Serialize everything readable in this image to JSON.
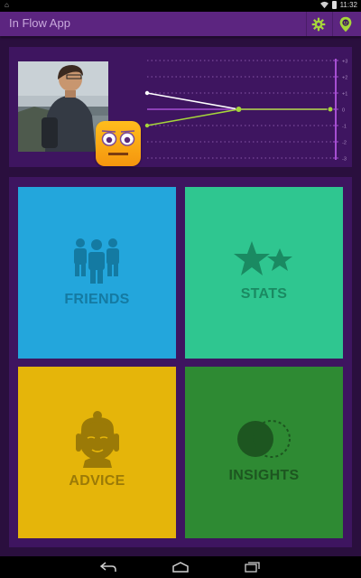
{
  "status_bar": {
    "time": "11:32"
  },
  "app_bar": {
    "title": "In Flow App",
    "actions": [
      {
        "name": "settings",
        "icon": "gear-icon"
      },
      {
        "name": "location",
        "icon": "map-pin-icon"
      }
    ]
  },
  "mood_graph": {
    "y_ticks": [
      "+3",
      "+2",
      "+1",
      "0",
      "-1",
      "-2",
      "-3"
    ],
    "series": [
      {
        "color": "#ffffff",
        "points": [
          {
            "x": 0,
            "y": 1
          },
          {
            "x": 0.5,
            "y": 0
          }
        ]
      },
      {
        "color": "#a6d63a",
        "points": [
          {
            "x": 0,
            "y": -1
          },
          {
            "x": 0.5,
            "y": 0
          },
          {
            "x": 1,
            "y": 0
          }
        ]
      }
    ],
    "colors": {
      "axis": "#a64fd2",
      "grid": "#7a4a99"
    }
  },
  "tiles": [
    {
      "label": "FRIENDS",
      "icon": "people-icon",
      "bg": "#23a6dc",
      "fg": "#147aa2"
    },
    {
      "label": "STATS",
      "icon": "stars-icon",
      "bg": "#2fc690",
      "fg": "#1a8a62"
    },
    {
      "label": "ADVICE",
      "icon": "buddha-icon",
      "bg": "#e5b50a",
      "fg": "#9b7a07"
    },
    {
      "label": "INSIGHTS",
      "icon": "venn-circles-icon",
      "bg": "#2e8a33",
      "fg": "#1d5620"
    }
  ]
}
